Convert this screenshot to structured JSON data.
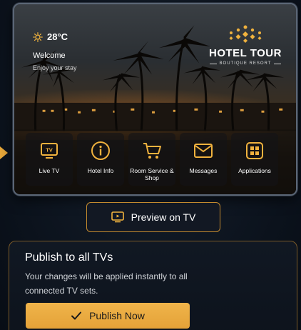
{
  "tv_preview": {
    "weather": {
      "temperature": "28°C",
      "icon": "sun-icon"
    },
    "welcome_title": "Welcome",
    "welcome_subtitle": "Enjoy your stay",
    "brand": {
      "title": "HOTEL TOUR",
      "subtitle": "BOUTIQUE RESORT"
    },
    "apps": [
      {
        "label": "Live TV",
        "icon": "tv-icon"
      },
      {
        "label": "Hotel Info",
        "icon": "info-icon"
      },
      {
        "label": "Room Service & Shop",
        "icon": "cart-icon"
      },
      {
        "label": "Messages",
        "icon": "mail-icon"
      },
      {
        "label": "Applications",
        "icon": "apps-grid-icon"
      }
    ]
  },
  "preview_button": {
    "label": "Preview on TV",
    "icon": "tv-preview-icon"
  },
  "publish": {
    "title": "Publish to all TVs",
    "description": "Your changes will be applied instantly to all connected TV sets.",
    "button_label": "Publish Now"
  },
  "colors": {
    "accent": "#f0b23e",
    "panel_border": "#7a5a28",
    "background": "#0c1420"
  }
}
